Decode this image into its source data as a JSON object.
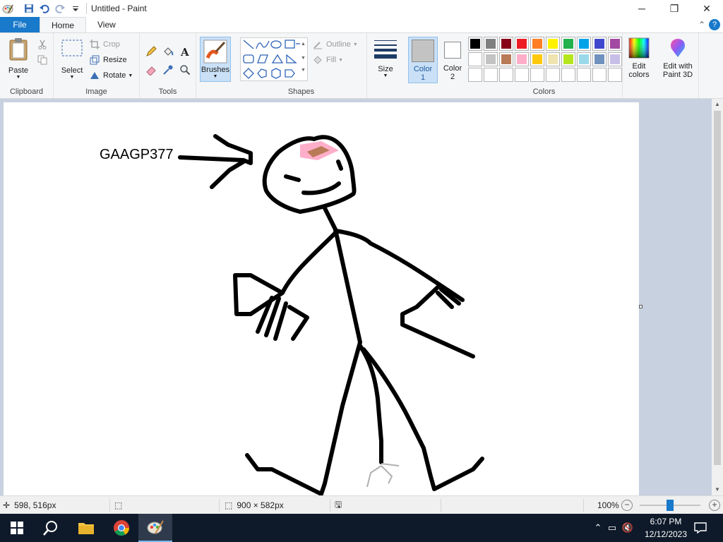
{
  "window": {
    "title": "Untitled - Paint",
    "controls": {
      "minimize": "─",
      "maximize": "❐",
      "close": "✕"
    }
  },
  "tabs": {
    "file": "File",
    "home": "Home",
    "view": "View"
  },
  "help": {
    "collapse": "⌃",
    "question": "?"
  },
  "ribbon": {
    "clipboard": {
      "paste": "Paste",
      "label": "Clipboard"
    },
    "image": {
      "select": "Select",
      "crop": "Crop",
      "resize": "Resize",
      "rotate": "Rotate",
      "label": "Image"
    },
    "tools": {
      "label": "Tools"
    },
    "brushes": {
      "label": "Brushes"
    },
    "shapes": {
      "outline": "Outline",
      "fill": "Fill",
      "label": "Shapes"
    },
    "size": {
      "label": "Size"
    },
    "color1": {
      "line1": "Color",
      "line2": "1",
      "value": "#c3c3c3"
    },
    "color2": {
      "line1": "Color",
      "line2": "2",
      "value": "#ffffff"
    },
    "colors": {
      "label": "Colors",
      "row1": [
        "#000000",
        "#7f7f7f",
        "#880015",
        "#ed1c24",
        "#ff7f27",
        "#fff200",
        "#22b14c",
        "#00a2e8",
        "#3f48cc",
        "#a349a4"
      ],
      "row2": [
        "#ffffff",
        "#c3c3c3",
        "#b97a57",
        "#ffaec9",
        "#ffc90e",
        "#efe4b0",
        "#b5e61d",
        "#99d9ea",
        "#7092be",
        "#c8bfe7"
      ],
      "row3": [
        "#ffffff",
        "#ffffff",
        "#ffffff",
        "#ffffff",
        "#ffffff",
        "#ffffff",
        "#ffffff",
        "#ffffff",
        "#ffffff",
        "#ffffff"
      ]
    },
    "edit_colors": {
      "line1": "Edit",
      "line2": "colors"
    },
    "paint3d": {
      "line1": "Edit with",
      "line2": "Paint 3D"
    }
  },
  "drawing": {
    "text": "GAAGP377"
  },
  "status": {
    "cursor_pos": "598, 516px",
    "image_size": "900 × 582px",
    "zoom": "100%",
    "zoom_level": 0.5
  },
  "taskbar": {
    "time": "6:07 PM",
    "date": "12/12/2023"
  }
}
